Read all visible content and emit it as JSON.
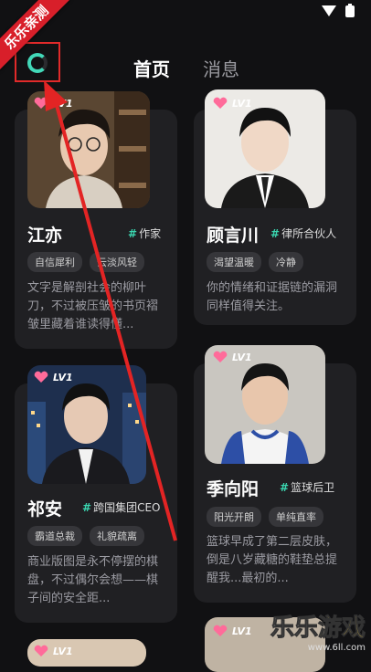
{
  "ribbon_text": "乐乐亲测",
  "tabs": [
    {
      "label": "首页",
      "active": true
    },
    {
      "label": "消息",
      "active": false
    }
  ],
  "cards": [
    {
      "level": "LV1",
      "name": "江亦",
      "role": "作家",
      "tags": [
        "自信犀利",
        "云淡风轻"
      ],
      "desc": "文字是解剖社会的柳叶刀，不过被压皱的书页褶皱里藏着谁读得懂..."
    },
    {
      "level": "LV1",
      "name": "顾言川",
      "role": "律所合伙人",
      "tags": [
        "渴望温暖",
        "冷静"
      ],
      "desc": "你的情绪和证据链的漏洞同样值得关注。"
    },
    {
      "level": "LV1",
      "name": "祁安",
      "role": "跨国集团CEO",
      "tags": [
        "霸道总裁",
        "礼貌疏离"
      ],
      "desc": "商业版图是永不停摆的棋盘，不过偶尔会想——棋子间的安全距..."
    },
    {
      "level": "LV1",
      "name": "季向阳",
      "role": "篮球后卫",
      "tags": [
        "阳光开朗",
        "单纯直率"
      ],
      "desc": "篮球早成了第二层皮肤，倒是八岁藏糖的鞋垫总提醒我...最初的..."
    }
  ],
  "partial_cards": [
    {
      "level": "LV1"
    },
    {
      "level": "LV1"
    }
  ],
  "watermark": {
    "main_1": "乐乐",
    "main_2": "游戏",
    "url": "www.6ll.com"
  },
  "colors": {
    "accent": "#3ad6b0",
    "background": "#111113",
    "card": "#202023",
    "ribbon": "#d81f2a"
  }
}
